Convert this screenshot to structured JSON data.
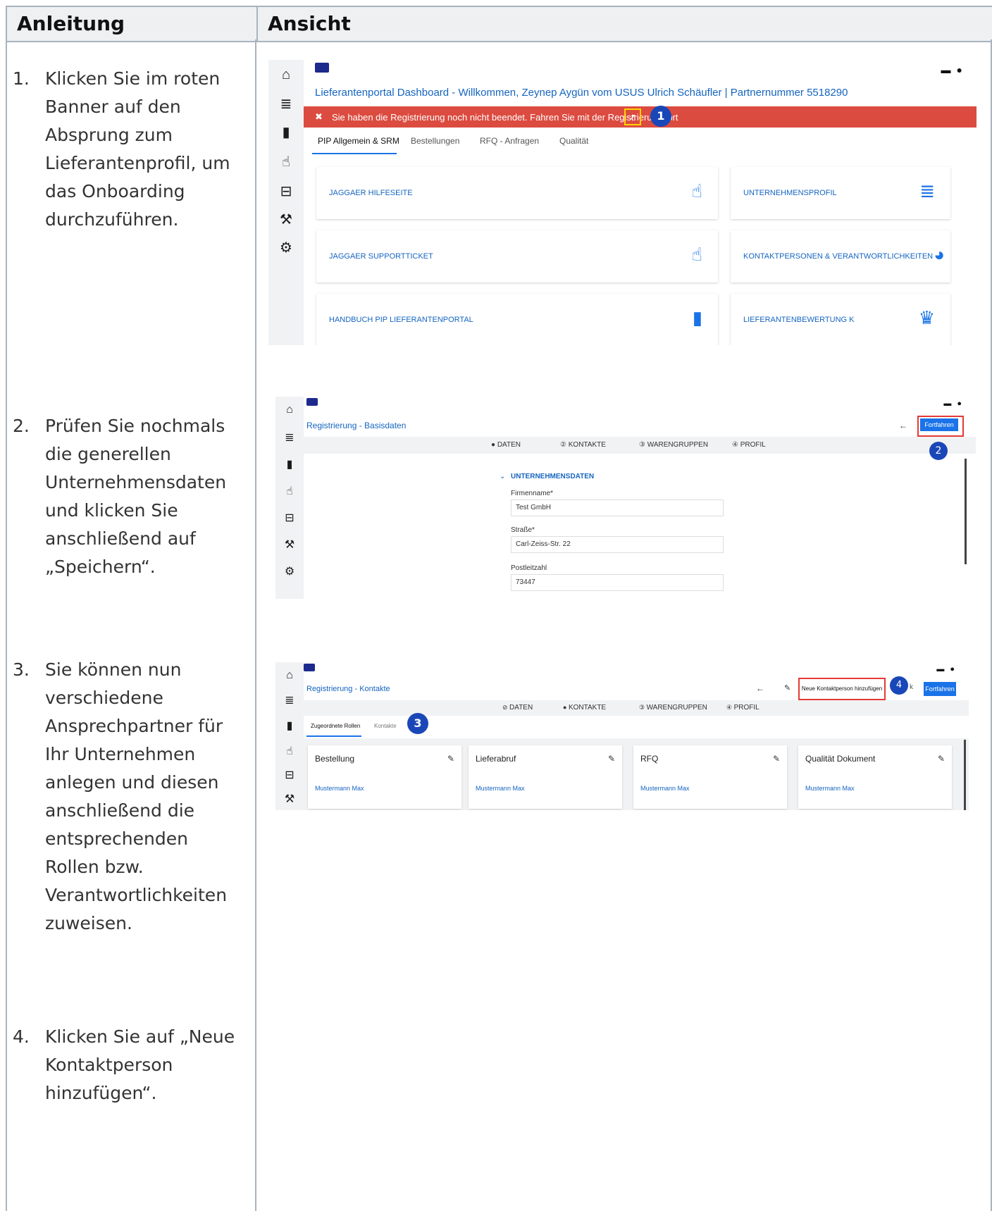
{
  "header": {
    "left": "Anleitung",
    "right": "Ansicht"
  },
  "steps": [
    {
      "num": "1.",
      "text": "Klicken Sie im roten Banner auf den Absprung zum Lieferantenprofil, um das Onboarding durchzuführen."
    },
    {
      "num": "2.",
      "text": "Prüfen Sie nochmals die generellen Unternehmensdaten und klicken Sie anschließend auf „Speichern“."
    },
    {
      "num": "3.",
      "text": "Sie können nun verschiedene Ansprechpartner für Ihr Unternehmen anlegen und diesen anschließend die entsprechenden Rollen bzw. Verantwortlichkeiten zuweisen."
    },
    {
      "num": "4.",
      "text": "Klicken Sie auf „Neue Kontaktperson hinzufügen“."
    }
  ],
  "shot1": {
    "title": "Lieferantenportal Dashboard - Willkommen, Zeynep Aygün vom USUS Ulrich Schäufler | Partnernummer 5518290",
    "banner_text": "Sie haben die Registrierung noch nicht beendet. Fahren Sie mit der Registrierung fort",
    "badge": "1",
    "tabs": [
      "PIP Allgemein & SRM",
      "Bestellungen",
      "RFQ - Anfragen",
      "Qualität"
    ],
    "tiles": [
      "JAGGAER HILFESEITE",
      "UNTERNEHMENSPROFIL",
      "JAGGAER SUPPORTTICKET",
      "KONTAKTPERSONEN & VERANTWORTLICHKEITEN",
      "HANDBUCH PIP LIEFERANTENPORTAL",
      "LIEFERANTENBEWERTUNG K"
    ]
  },
  "shot2": {
    "title": "Registrierung - Basisdaten",
    "button": "Fortfahren",
    "badge": "2",
    "steps": [
      "DATEN",
      "KONTAKTE",
      "WARENGRUPPEN",
      "PROFIL"
    ],
    "section": "UNTERNEHMENSDATEN",
    "fields": [
      {
        "label": "Firmenname*",
        "value": "Test GmbH"
      },
      {
        "label": "Straße*",
        "value": "Carl-Zeiss-Str. 22"
      },
      {
        "label": "Postleitzahl",
        "value": "73447"
      }
    ]
  },
  "shot3": {
    "title": "Registrierung - Kontakte",
    "add_button": "Neue Kontaktperson hinzufügen",
    "badge4": "4",
    "cut_text": "k",
    "button": "Fortfahren",
    "steps": [
      "DATEN",
      "KONTAKTE",
      "WARENGRUPPEN",
      "PROFIL"
    ],
    "tabs": [
      "Zugeordnete Rollen",
      "Kontakte"
    ],
    "badge3": "3",
    "cards": [
      {
        "title": "Bestellung",
        "contact": "Mustermann Max"
      },
      {
        "title": "Lieferabruf",
        "contact": "Mustermann Max"
      },
      {
        "title": "RFQ",
        "contact": "Mustermann Max"
      },
      {
        "title": "Qualität Dokument",
        "contact": "Mustermann Max"
      }
    ]
  }
}
